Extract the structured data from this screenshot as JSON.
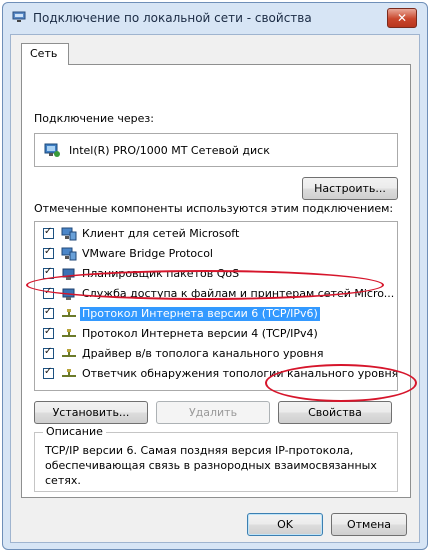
{
  "window": {
    "title": "Подключение по локальной сети - свойства",
    "close_label": "✕"
  },
  "tabs": [
    {
      "label": "Сеть",
      "active": true
    }
  ],
  "connect_via": {
    "label": "Подключение через:",
    "adapter": "Intel(R) PRO/1000 MT Сетевой диск",
    "configure_button": "Настроить..."
  },
  "components": {
    "label": "Отмеченные компоненты используются этим подключением:",
    "items": [
      {
        "label": "Клиент для сетей Microsoft",
        "checked": true,
        "icon": "network-client-icon"
      },
      {
        "label": "VMware Bridge Protocol",
        "checked": true,
        "icon": "network-client-icon"
      },
      {
        "label": "Планировщик пакетов QoS",
        "checked": true,
        "icon": "network-service-icon"
      },
      {
        "label": "Служба доступа к файлам и принтерам сетей Micro...",
        "checked": true,
        "icon": "network-service-icon"
      },
      {
        "label": "Протокол Интернета версии 6 (TCP/IPv6)",
        "checked": true,
        "icon": "protocol-icon",
        "selected": true
      },
      {
        "label": "Протокол Интернета версии 4 (TCP/IPv4)",
        "checked": true,
        "icon": "protocol-icon"
      },
      {
        "label": "Драйвер в/в тополога канального уровня",
        "checked": true,
        "icon": "protocol-icon"
      },
      {
        "label": "Ответчик обнаружения топологии канального уровня",
        "checked": true,
        "icon": "protocol-icon"
      }
    ]
  },
  "buttons": {
    "install": "Установить...",
    "remove": "Удалить",
    "properties": "Свойства",
    "ok": "OK",
    "cancel": "Отмена"
  },
  "description": {
    "legend": "Описание",
    "text": "TCP/IP версии 6. Самая поздняя версия IP-протокола, обеспечивающая связь в разнородных взаимосвязанных сетях."
  },
  "colors": {
    "selection": "#3399ff",
    "annotation": "#d6152b",
    "title_bar": "#d7e5f5"
  }
}
